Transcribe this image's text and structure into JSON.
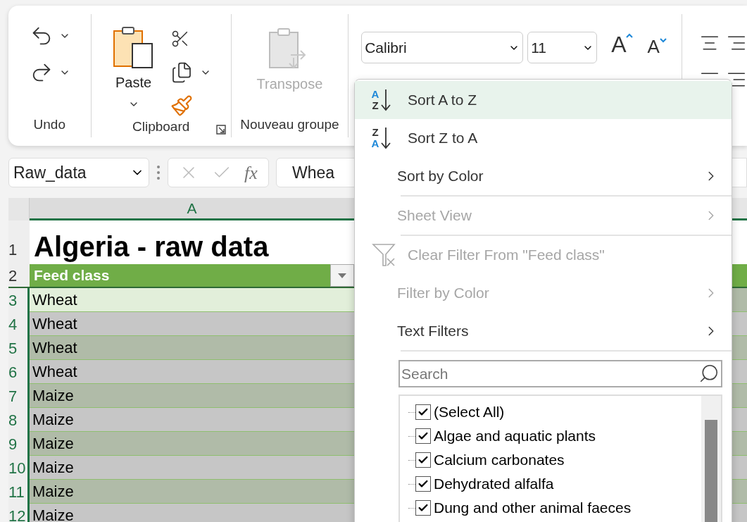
{
  "ribbon": {
    "groups": [
      {
        "kind": "undo",
        "label": "Undo"
      },
      {
        "kind": "clipboard",
        "label": "Clipboard",
        "paste_label": "Paste"
      },
      {
        "kind": "transpose",
        "label": "Nouveau groupe",
        "transpose_label": "Transpose",
        "disabled": true
      },
      {
        "kind": "font",
        "font_name": "Calibri",
        "font_size": "11",
        "grow_glyph": "A",
        "shrink_glyph": "A"
      },
      {
        "kind": "alignment"
      }
    ]
  },
  "formula_bar": {
    "name_box": "Raw_data",
    "fx": "fx",
    "value": "Whea"
  },
  "sheet": {
    "column_header": "A",
    "title_row": {
      "row_number": "1",
      "text": "Algeria - raw data"
    },
    "header_row": {
      "row_number": "2",
      "text": "Feed class"
    },
    "rows": [
      {
        "row_number": "3",
        "value": "Wheat",
        "selected": true,
        "active": true
      },
      {
        "row_number": "4",
        "value": "Wheat",
        "selected": true,
        "active": false
      },
      {
        "row_number": "5",
        "value": "Wheat",
        "selected": true,
        "active": false
      },
      {
        "row_number": "6",
        "value": "Wheat",
        "selected": true,
        "active": false
      },
      {
        "row_number": "7",
        "value": "Maize",
        "selected": true,
        "active": false
      },
      {
        "row_number": "8",
        "value": "Maize",
        "selected": true,
        "active": false
      },
      {
        "row_number": "9",
        "value": "Maize",
        "selected": true,
        "active": false
      },
      {
        "row_number": "10",
        "value": "Maize",
        "selected": true,
        "active": false
      },
      {
        "row_number": "11",
        "value": "Maize",
        "selected": true,
        "active": false
      },
      {
        "row_number": "12",
        "value": "Maize",
        "selected": true,
        "active": false
      }
    ]
  },
  "filter_menu": {
    "items": [
      {
        "kind": "sort",
        "label": "Sort A to Z",
        "icon_top": "A",
        "icon_bottom": "Z",
        "highlighted": true,
        "disabled": false,
        "submenu": false
      },
      {
        "kind": "sort",
        "label": "Sort Z to A",
        "icon_top": "Z",
        "icon_bottom": "A",
        "highlighted": false,
        "disabled": false,
        "submenu": false
      },
      {
        "kind": "plain",
        "label": "Sort by Color",
        "highlighted": false,
        "disabled": false,
        "submenu": true,
        "separator_after": true
      },
      {
        "kind": "plain",
        "label": "Sheet View",
        "highlighted": false,
        "disabled": true,
        "submenu": true,
        "separator_after": true
      },
      {
        "kind": "clear",
        "label": "Clear Filter From \"Feed class\"",
        "highlighted": false,
        "disabled": true,
        "submenu": false
      },
      {
        "kind": "plain",
        "label": "Filter by Color",
        "highlighted": false,
        "disabled": true,
        "submenu": true
      },
      {
        "kind": "plain",
        "label": "Text Filters",
        "highlighted": false,
        "disabled": false,
        "submenu": true,
        "separator_after": true
      }
    ],
    "search": {
      "placeholder": "Search"
    },
    "values": [
      {
        "label": "(Select All)",
        "checked": true
      },
      {
        "label": "Algae and aquatic plants",
        "checked": true
      },
      {
        "label": "Calcium carbonates",
        "checked": true
      },
      {
        "label": "Dehydrated alfalfa",
        "checked": true
      },
      {
        "label": "Dung and other animal faeces",
        "checked": true
      }
    ]
  }
}
